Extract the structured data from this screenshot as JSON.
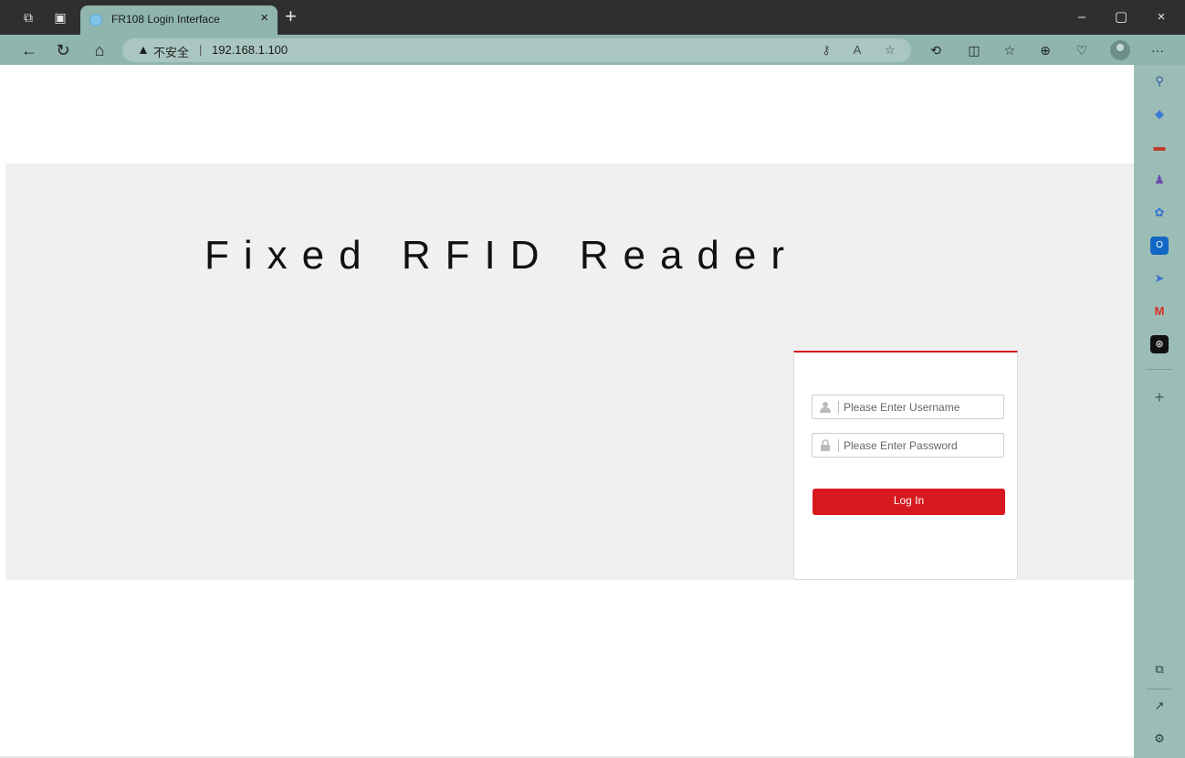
{
  "tab": {
    "title": "FR108 Login Interface",
    "close": "×",
    "new_tab": "+"
  },
  "window_controls": {
    "minimize": "–",
    "maximize": "▢",
    "close": "×"
  },
  "address_bar": {
    "warning_icon": "▲",
    "security_label": "不安全",
    "separator": "|",
    "url": "192.168.1.100"
  },
  "toolbar_icons": [
    "key-icon",
    "read-aloud-icon",
    "favorite-star-icon",
    "extensions-icon",
    "split-screen-icon",
    "favorites-icon",
    "collections-icon",
    "health-icon",
    "profile-icon",
    "more-icon"
  ],
  "sidebar_icons": [
    "search-icon",
    "tag-icon",
    "toolbox-icon",
    "games-icon",
    "copilot-icon",
    "outlook-icon",
    "send-icon",
    "gmail-icon",
    "chatgpt-icon",
    "add-icon",
    "screenshot-icon",
    "open-external-icon",
    "settings-icon"
  ],
  "page": {
    "heading": "Fixed RFID Reader",
    "username_placeholder": "Please Enter Username",
    "password_placeholder": "Please Enter Password",
    "login_label": "Log In"
  },
  "colors": {
    "accent": "#d7191f",
    "frame": "#8fb5ad",
    "banner": "#f0f0f0"
  }
}
